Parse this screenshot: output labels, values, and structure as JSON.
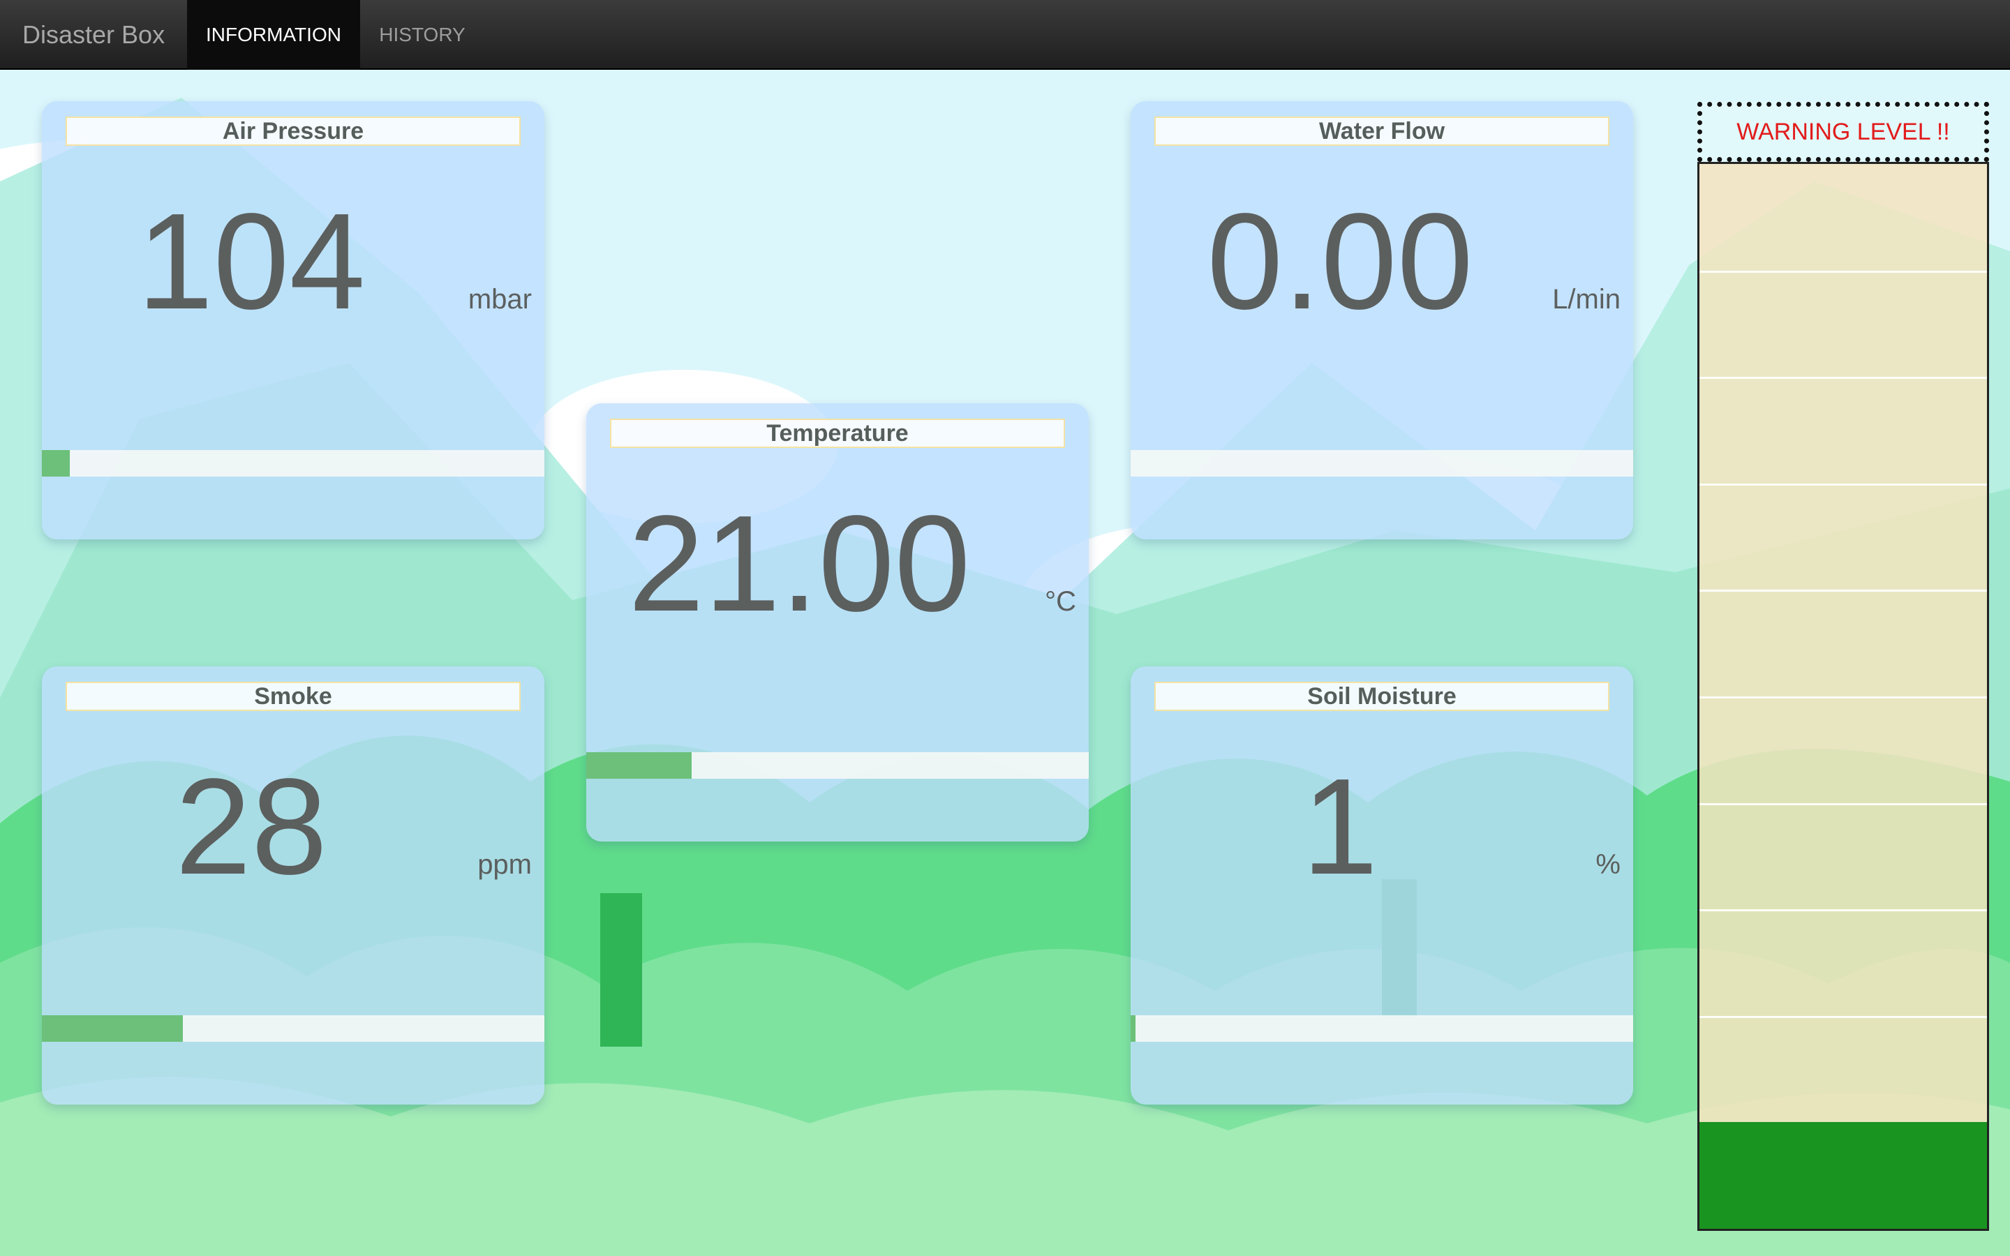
{
  "navbar": {
    "brand": "Disaster Box",
    "tabs": [
      {
        "label": "INFORMATION",
        "active": true
      },
      {
        "label": "HISTORY",
        "active": false
      }
    ]
  },
  "cards": {
    "air_pressure": {
      "title": "Air Pressure",
      "value": "104",
      "unit": "mbar",
      "bar_fraction": 0.055
    },
    "water_flow": {
      "title": "Water Flow",
      "value": "0.00",
      "unit": "L/min",
      "bar_fraction": 0.0
    },
    "temperature": {
      "title": "Temperature",
      "value": "21.00",
      "unit": "°C",
      "bar_fraction": 0.21
    },
    "smoke": {
      "title": "Smoke",
      "value": "28",
      "unit": "ppm",
      "bar_fraction": 0.28
    },
    "soil_moisture": {
      "title": "Soil Moisture",
      "value": "1",
      "unit": "%",
      "bar_fraction": 0.01
    }
  },
  "warning": {
    "title": "WARNING LEVEL !!",
    "levels": 10,
    "current_level": 1
  },
  "colors": {
    "bar_fill": "#6cc07a",
    "warning_text": "#e21b1b",
    "warning_fill": "#199420"
  }
}
